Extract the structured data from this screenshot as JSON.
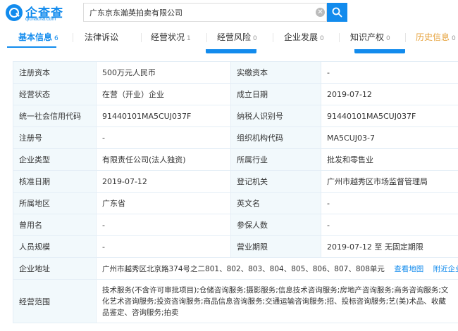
{
  "header": {
    "logo_text": "企查查",
    "logo_sub": "qichacha.com",
    "search_value": "广东京东瀚英拍卖有限公司",
    "clear_glyph": "✕",
    "search_icon": "search-icon"
  },
  "tabs": [
    {
      "label": "基本信息",
      "count": "6"
    },
    {
      "label": "法律诉讼",
      "count": ""
    },
    {
      "label": "经营状况",
      "count": "1"
    },
    {
      "label": "经营风险",
      "count": "0"
    },
    {
      "label": "企业发展",
      "count": "0"
    },
    {
      "label": "知识产权",
      "count": "0"
    },
    {
      "label": "历史信息",
      "count": "0"
    }
  ],
  "info": {
    "reg_capital_label": "注册资本",
    "reg_capital": "500万元人民币",
    "paid_capital_label": "实缴资本",
    "paid_capital": "-",
    "status_label": "经营状态",
    "status": "在营（开业）企业",
    "established_label": "成立日期",
    "established": "2019-07-12",
    "credit_code_label": "统一社会信用代码",
    "credit_code": "91440101MA5CUJ037F",
    "taxpayer_label": "纳税人识别号",
    "taxpayer": "91440101MA5CUJ037F",
    "reg_no_label": "注册号",
    "reg_no": "-",
    "org_code_label": "组织机构代码",
    "org_code": "MA5CUJ03-7",
    "type_label": "企业类型",
    "type": "有限责任公司(法人独资)",
    "industry_label": "所属行业",
    "industry": "批发和零售业",
    "approval_label": "核准日期",
    "approval": "2019-07-12",
    "authority_label": "登记机关",
    "authority": "广州市越秀区市场监督管理局",
    "region_label": "所属地区",
    "region": "广东省",
    "english_label": "英文名",
    "english": "-",
    "former_label": "曾用名",
    "former": "-",
    "insured_label": "参保人数",
    "insured": "-",
    "staff_label": "人员规模",
    "staff": "-",
    "term_label": "营业期限",
    "term": "2019-07-12 至 无固定期限",
    "address_label": "企业地址",
    "address": "广州市越秀区北京路374号之二801、802、803、804、805、806、807、808单元",
    "map_link": "查看地图",
    "nearby_link": "附近企业",
    "scope_label": "经营范围",
    "scope": "技术服务(不含许可审批项目);仓储咨询服务;摄影服务;信息技术咨询服务;房地产咨询服务;商务咨询服务;文化艺术咨询服务;投资咨询服务;商品信息咨询服务;交通运输咨询服务;招、投标咨询服务;艺(美)术品、收藏品鉴定、咨询服务;拍卖"
  }
}
